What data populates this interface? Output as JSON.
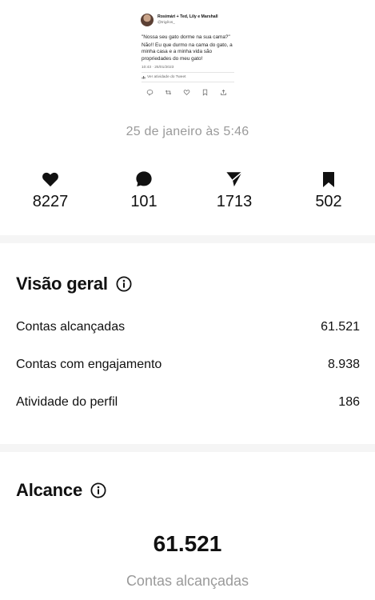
{
  "tweet": {
    "author_name": "Rosimári + Ted, Lily e Marshall",
    "handle": "@trigêos_",
    "lines": [
      "\"Nossa seu gato dorme na sua cama?\"",
      "Não!! Eu que durmo na cama do gato, a minha casa e a minha vida são propriedades do meu gato!"
    ],
    "timestamp": "10:43 · 25/01/2023",
    "activity_label": "Ver atividade do Tweet",
    "action_icons": [
      "reply-icon",
      "retweet-icon",
      "like-icon",
      "bookmark-icon",
      "share-icon"
    ]
  },
  "post_date": "25 de janeiro às 5:46",
  "engagement": {
    "likes": "8227",
    "comments": "101",
    "shares": "1713",
    "saves": "502"
  },
  "overview": {
    "title": "Visão geral",
    "rows": [
      {
        "label": "Contas alcançadas",
        "value": "61.521"
      },
      {
        "label": "Contas com engajamento",
        "value": "8.938"
      },
      {
        "label": "Atividade do perfil",
        "value": "186"
      }
    ]
  },
  "reach": {
    "title": "Alcance",
    "value": "61.521",
    "label": "Contas alcançadas"
  },
  "colors": {
    "text": "#111111",
    "muted": "#9a9a9a",
    "divider_band": "#f5f5f5"
  }
}
